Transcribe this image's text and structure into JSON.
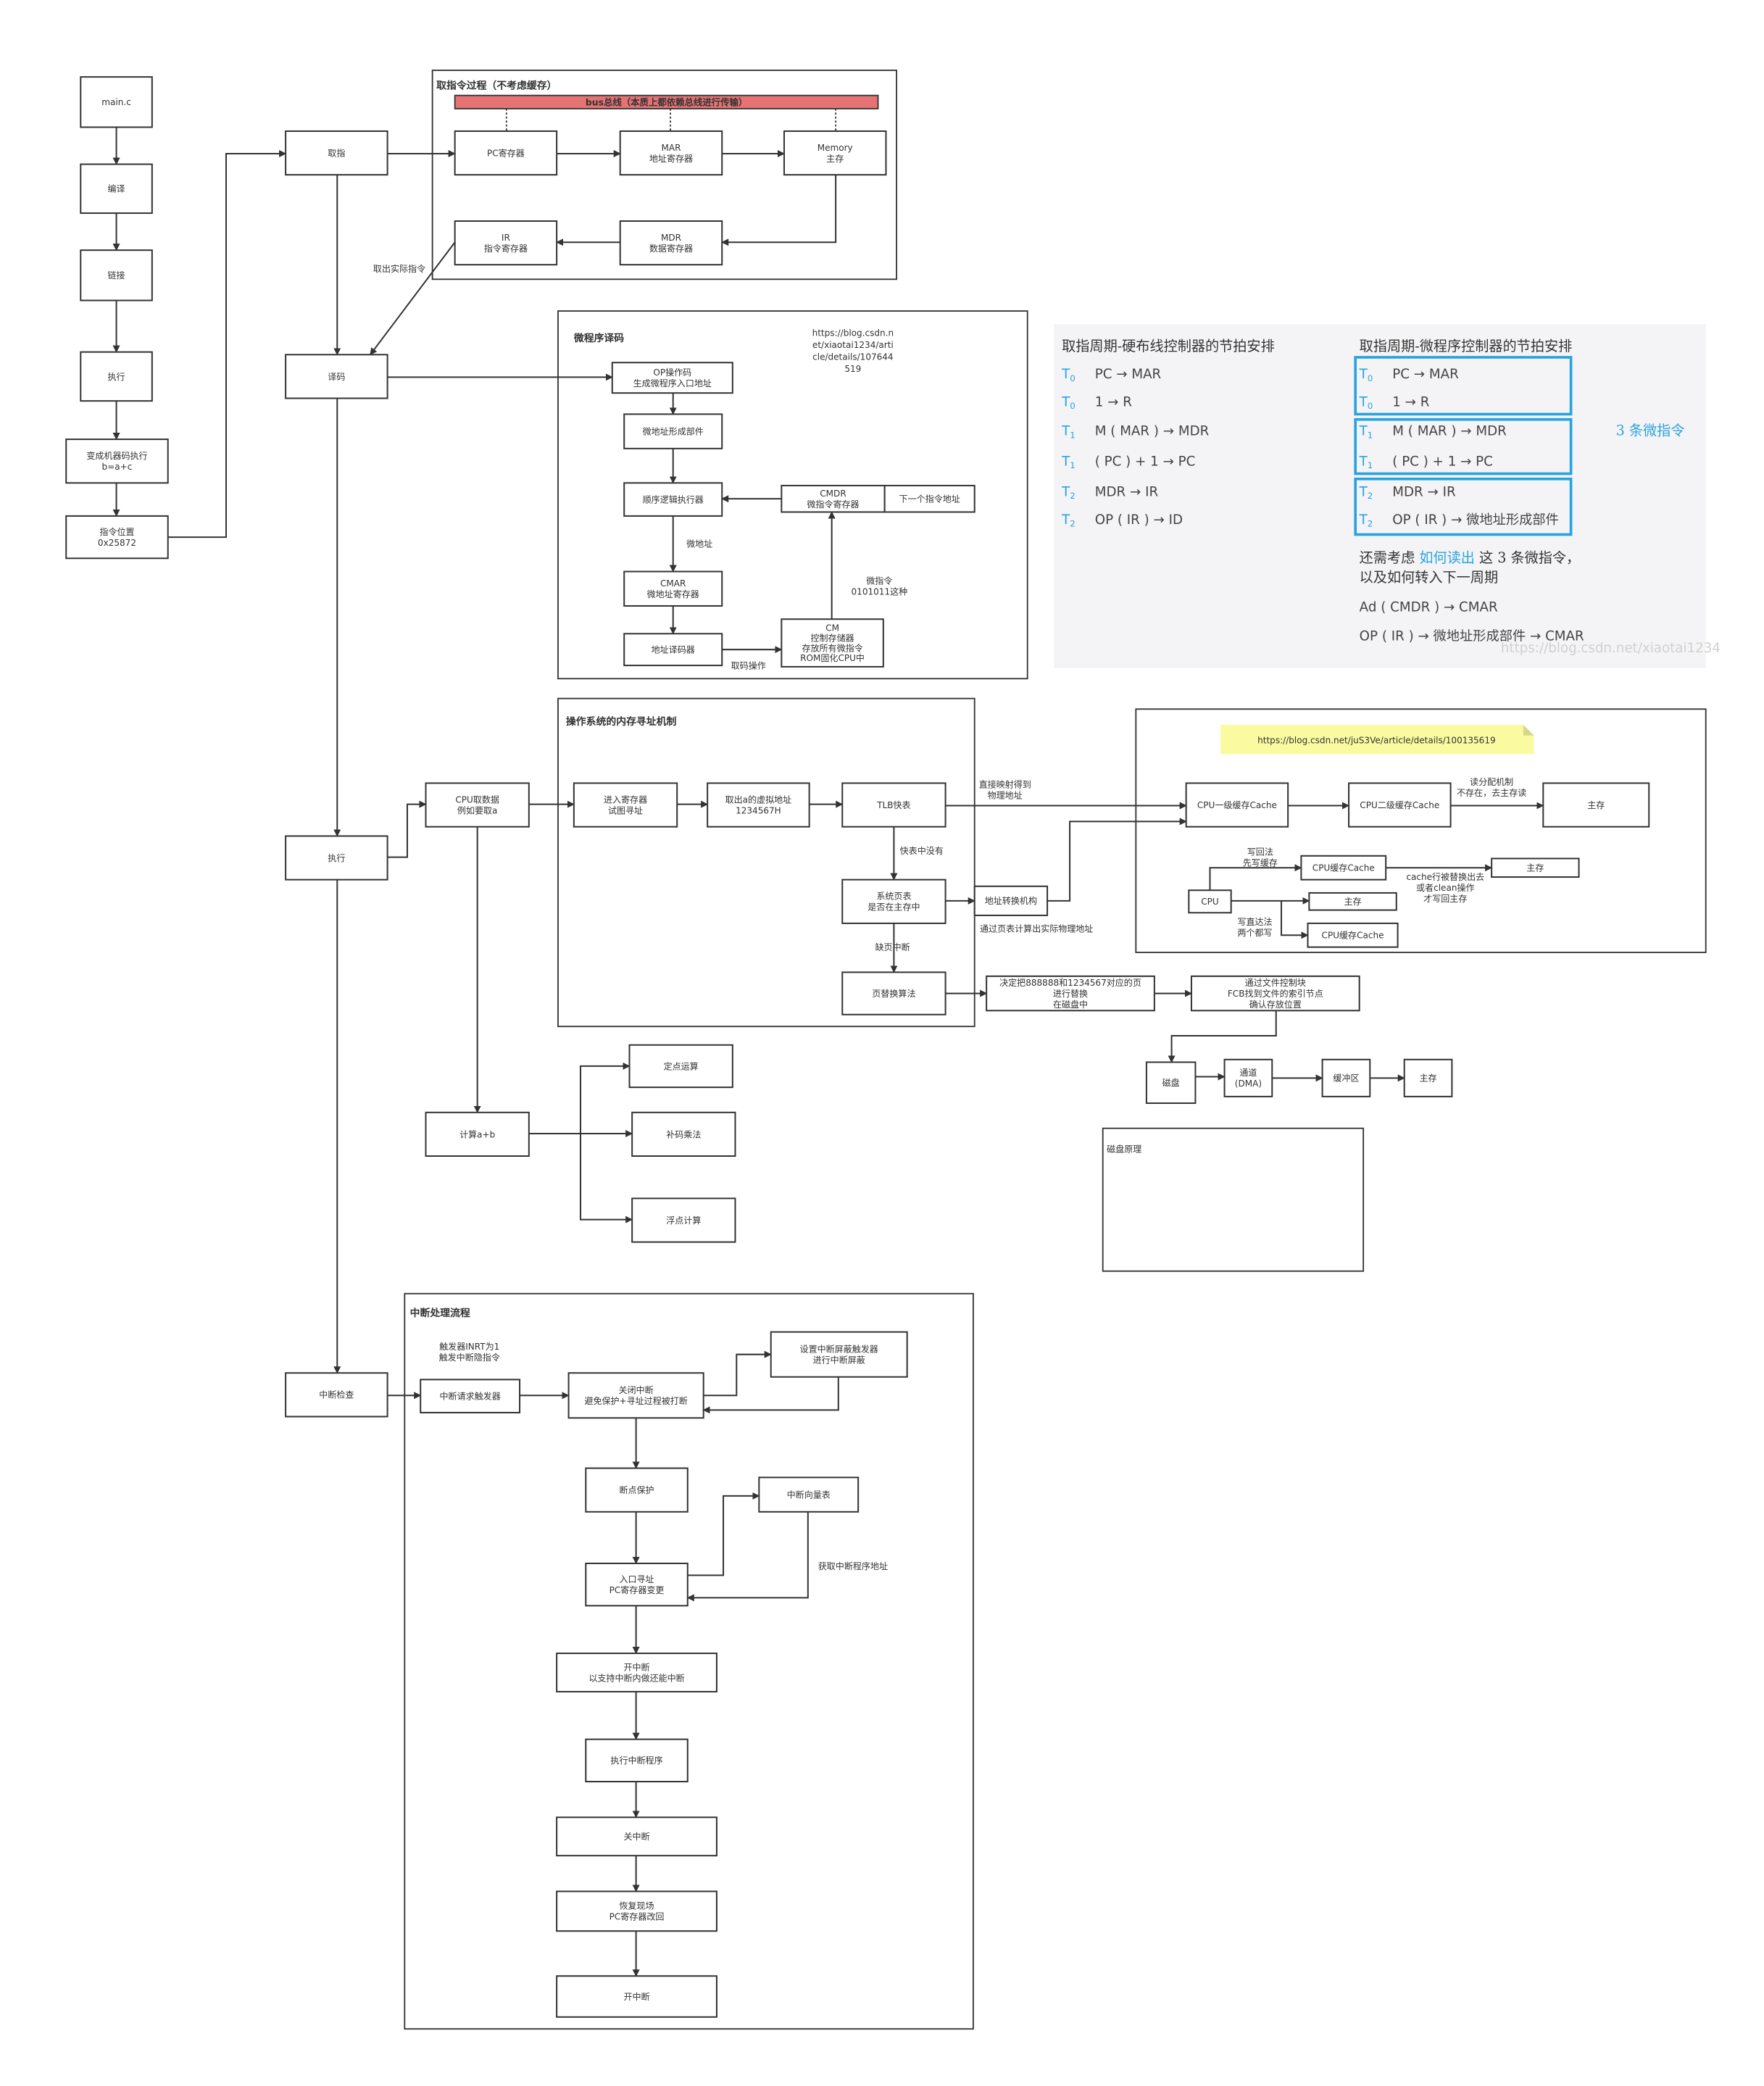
{
  "colors": {
    "bus": "#e57373",
    "note": "#fafaa0",
    "note_fold": "#d6d68a",
    "accent_blue": "#29a3e0",
    "line": "#333333",
    "screenshot_bg": "#f4f4f6"
  },
  "groups": {
    "fetch": {
      "title": "取指令过程（不考虑缓存）",
      "bus": "bus总线（本质上都依赖总线进行传输）"
    },
    "micro": {
      "title": "微程序译码",
      "url": [
        "https://blog.csdn.n",
        "et/xiaotai1234/arti",
        "cle/details/107644",
        "519"
      ]
    },
    "os": {
      "title": "操作系统的内存寻址机制"
    },
    "cache": {
      "note": "https://blog.csdn.net/juS3Ve/article/details/100135619"
    },
    "disk": {
      "title": "磁盘原理"
    },
    "interrupt": {
      "title": "中断处理流程"
    }
  },
  "nodes": {
    "main_c": {
      "lines": [
        "main.c"
      ]
    },
    "compile": {
      "lines": [
        "编译"
      ]
    },
    "link": {
      "lines": [
        "链接"
      ]
    },
    "exec1": {
      "lines": [
        "执行"
      ]
    },
    "machine": {
      "lines": [
        "变成机器码执行",
        "b=a+c"
      ]
    },
    "instr_pos": {
      "lines": [
        "指令位置",
        "0x25872"
      ]
    },
    "fetch": {
      "lines": [
        "取指"
      ]
    },
    "decode": {
      "lines": [
        "译码"
      ]
    },
    "exec2": {
      "lines": [
        "执行"
      ]
    },
    "int_check": {
      "lines": [
        "中断检查"
      ]
    },
    "pc": {
      "lines": [
        "PC寄存器"
      ]
    },
    "mar": {
      "lines": [
        "MAR",
        "地址寄存器"
      ]
    },
    "memory": {
      "lines": [
        "Memory",
        "主存"
      ]
    },
    "ir": {
      "lines": [
        "IR",
        "指令寄存器"
      ]
    },
    "mdr": {
      "lines": [
        "MDR",
        "数据寄存器"
      ]
    },
    "op": {
      "lines": [
        "OP操作码",
        "生成微程序入口地址"
      ]
    },
    "micro_addr": {
      "lines": [
        "微地址形成部件"
      ]
    },
    "seq": {
      "lines": [
        "顺序逻辑执行器"
      ]
    },
    "cmdr": {
      "lines": [
        "CMDR",
        "微指令寄存器"
      ]
    },
    "next_addr": {
      "lines": [
        "下一个指令地址"
      ]
    },
    "cmar": {
      "lines": [
        "CMAR",
        "微地址寄存器"
      ]
    },
    "addr_dec": {
      "lines": [
        "地址译码器"
      ]
    },
    "cm": {
      "lines": [
        "CM",
        "控制存储器",
        "存放所有微指令",
        "ROM固化CPU中"
      ]
    },
    "cpu_fetch": {
      "lines": [
        "CPU取数据",
        "例如要取a"
      ]
    },
    "enter_reg": {
      "lines": [
        "进入寄存器",
        "试图寻址"
      ]
    },
    "virt_addr": {
      "lines": [
        "取出a的虚拟地址",
        "1234567H"
      ]
    },
    "tlb": {
      "lines": [
        "TLB快表"
      ]
    },
    "page_table": {
      "lines": [
        "系统页表",
        "是否在主存中"
      ]
    },
    "addr_trans": {
      "lines": [
        "地址转换机构"
      ]
    },
    "page_replace": {
      "lines": [
        "页替换算法"
      ]
    },
    "decide": {
      "lines": [
        "决定把888888和1234567对应的页",
        "进行替换",
        "在磁盘中"
      ]
    },
    "fcb": {
      "lines": [
        "通过文件控制块",
        "FCB找到文件的索引节点",
        "确认存放位置"
      ]
    },
    "disk": {
      "lines": [
        "磁盘"
      ]
    },
    "dma": {
      "lines": [
        "通道",
        "(DMA)"
      ]
    },
    "buffer": {
      "lines": [
        "缓冲区"
      ]
    },
    "mem_final": {
      "lines": [
        "主存"
      ]
    },
    "calc": {
      "lines": [
        "计算a+b"
      ]
    },
    "fixed": {
      "lines": [
        "定点运算"
      ]
    },
    "mul": {
      "lines": [
        "补码乘法"
      ]
    },
    "float": {
      "lines": [
        "浮点计算"
      ]
    },
    "l1": {
      "lines": [
        "CPU一级缓存Cache"
      ]
    },
    "l2": {
      "lines": [
        "CPU二级缓存Cache"
      ]
    },
    "main_mem": {
      "lines": [
        "主存"
      ]
    },
    "cpu": {
      "lines": [
        "CPU"
      ]
    },
    "wb_cache": {
      "lines": [
        "CPU缓存Cache"
      ]
    },
    "wb_mem": {
      "lines": [
        "主存"
      ]
    },
    "wt_mem": {
      "lines": [
        "主存"
      ]
    },
    "wt_cache": {
      "lines": [
        "CPU缓存Cache"
      ]
    },
    "int_req": {
      "lines": [
        "中断请求触发器"
      ]
    },
    "close_int": {
      "lines": [
        "关闭中断",
        "避免保护+寻址过程被打断"
      ]
    },
    "set_mask": {
      "lines": [
        "设置中断屏蔽触发器",
        "进行中断屏蔽"
      ]
    },
    "bp": {
      "lines": [
        "断点保护"
      ]
    },
    "entry": {
      "lines": [
        "入口寻址",
        "PC寄存器变更"
      ]
    },
    "vector": {
      "lines": [
        "中断向量表"
      ]
    },
    "open1": {
      "lines": [
        "开中断",
        "以支持中断内做还能中断"
      ]
    },
    "run_isr": {
      "lines": [
        "执行中断程序"
      ]
    },
    "close2": {
      "lines": [
        "关中断"
      ]
    },
    "restore": {
      "lines": [
        "恢复现场",
        "PC寄存器改回"
      ]
    },
    "open2": {
      "lines": [
        "开中断"
      ]
    }
  },
  "labels": {
    "fetch_actual": {
      "lines": [
        "取出实际指令"
      ]
    },
    "micro_addr_lbl": {
      "lines": [
        "微地址"
      ]
    },
    "micro_instr": {
      "lines": [
        "微指令",
        "0101011这种"
      ]
    },
    "fetch_code": {
      "lines": [
        "取码操作"
      ]
    },
    "direct_map": {
      "lines": [
        "直接映射得到",
        "物理地址"
      ]
    },
    "tlb_miss": {
      "lines": [
        "快表中没有"
      ]
    },
    "page_calc": {
      "lines": [
        "通过页表计算出实际物理地址"
      ]
    },
    "page_fault": {
      "lines": [
        "缺页中断"
      ]
    },
    "read_alloc": {
      "lines": [
        "读分配机制",
        "不存在，去主存读"
      ]
    },
    "write_back": {
      "lines": [
        "写回法",
        "先写缓存"
      ]
    },
    "wb_note": {
      "lines": [
        "cache行被替换出去",
        "或者clean操作",
        "才写回主存"
      ]
    },
    "write_through": {
      "lines": [
        "写直达法",
        "两个都写"
      ]
    },
    "trigger": {
      "lines": [
        "触发器INRT为1",
        "触发中断隐指令"
      ]
    },
    "get_addr": {
      "lines": [
        "获取中断程序地址"
      ]
    }
  },
  "screenshot": {
    "left_title": "取指周期-硬布线控制器的节拍安排",
    "right_title": "取指周期-微程序控制器的节拍安排",
    "left_rows": [
      {
        "t": "T",
        "sub": "0",
        "op": "PC → MAR"
      },
      {
        "t": "T",
        "sub": "0",
        "op": "1 → R"
      },
      {
        "t": "T",
        "sub": "1",
        "op": "M ( MAR ) → MDR"
      },
      {
        "t": "T",
        "sub": "1",
        "op": "( PC ) + 1 → PC"
      },
      {
        "t": "T",
        "sub": "2",
        "op": "MDR → IR"
      },
      {
        "t": "T",
        "sub": "2",
        "op": "OP ( IR ) → ID"
      }
    ],
    "right_rows": [
      {
        "t": "T",
        "sub": "0",
        "op": "PC → MAR"
      },
      {
        "t": "T",
        "sub": "0",
        "op": "1 → R"
      },
      {
        "t": "T",
        "sub": "1",
        "op": "M ( MAR ) → MDR"
      },
      {
        "t": "T",
        "sub": "1",
        "op": "( PC ) + 1 → PC"
      },
      {
        "t": "T",
        "sub": "2",
        "op": "MDR → IR"
      },
      {
        "t": "T",
        "sub": "2",
        "op": "OP ( IR ) → 微地址形成部件"
      }
    ],
    "micro_count": "3 条微指令",
    "note_a": "还需考虑 ",
    "note_highlight": "如何读出",
    "note_b": " 这 3 条微指令，",
    "note_line2": "以及如何转入下一周期",
    "formula1": "Ad ( CMDR ) → CMAR",
    "formula2": "OP ( IR ) → 微地址形成部件 → CMAR",
    "watermark": "https://blog.csdn.net/xiaotai1234"
  }
}
